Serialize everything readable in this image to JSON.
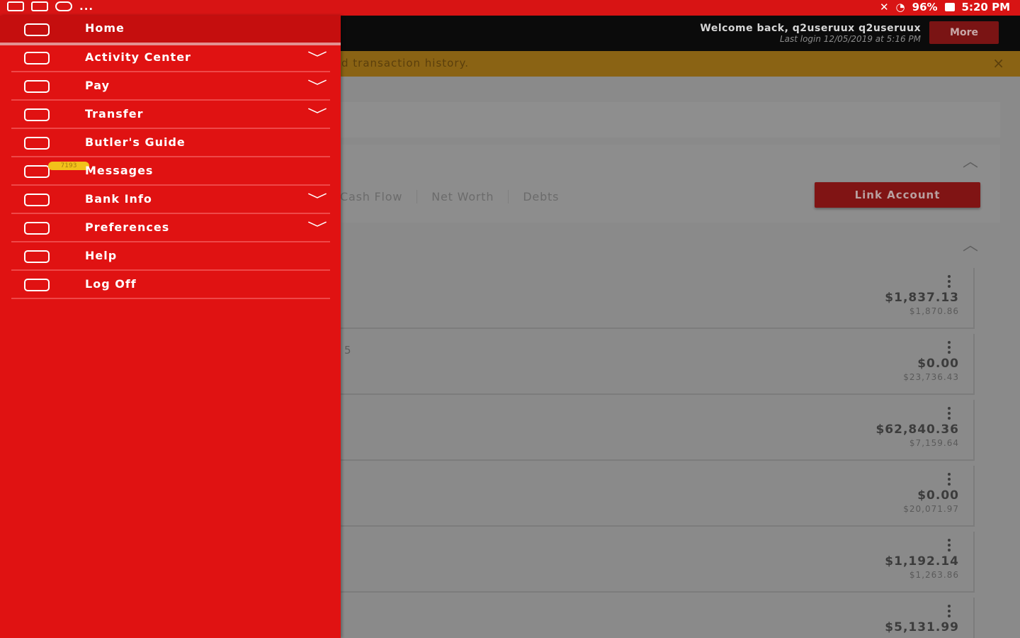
{
  "status_bar": {
    "left_dots": "...",
    "battery": "96%",
    "time": "5:20 PM"
  },
  "header": {
    "welcome": "Welcome back, q2useruux q2useruux",
    "last_login": "Last login 12/05/2019 at 5:16 PM",
    "more_label": "More"
  },
  "banner": {
    "text": "d transaction history.",
    "close": "×"
  },
  "overview": {
    "tabs": [
      "Cash Flow",
      "Net Worth",
      "Debts"
    ],
    "link_account_label": "Link Account",
    "collapse_icon": "︿"
  },
  "accounts": [
    {
      "balance": "$1,837.13",
      "available": "$1,870.86",
      "fragment": ""
    },
    {
      "balance": "$0.00",
      "available": "$23,736.43",
      "fragment": "5"
    },
    {
      "balance": "$62,840.36",
      "available": "$7,159.64",
      "fragment": ""
    },
    {
      "balance": "$0.00",
      "available": "$20,071.97",
      "fragment": ""
    },
    {
      "balance": "$1,192.14",
      "available": "$1,263.86",
      "fragment": ""
    },
    {
      "balance": "$5,131.99",
      "available": "",
      "fragment": ""
    }
  ],
  "drawer": {
    "home_label": "Home",
    "chevron": "﹀",
    "items": [
      {
        "label": "Activity Center",
        "has_chevron": true
      },
      {
        "label": "Pay",
        "has_chevron": true
      },
      {
        "label": "Transfer",
        "has_chevron": true
      },
      {
        "label": "Butler's Guide",
        "has_chevron": false
      },
      {
        "label": "Messages",
        "has_chevron": false,
        "badge": "7193"
      },
      {
        "label": "Bank Info",
        "has_chevron": true
      },
      {
        "label": "Preferences",
        "has_chevron": true
      },
      {
        "label": "Help",
        "has_chevron": false
      },
      {
        "label": "Log Off",
        "has_chevron": false
      }
    ]
  },
  "colors": {
    "brand_red": "#e01212",
    "status_bar_red": "#d81414",
    "badge_yellow": "#f2c21a"
  }
}
